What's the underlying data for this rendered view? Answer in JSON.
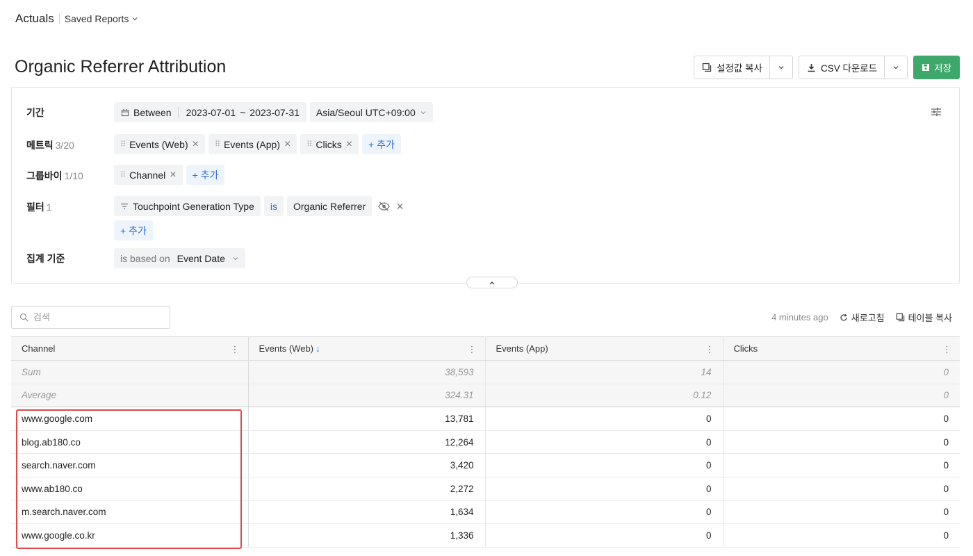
{
  "nav": {
    "brand": "Actuals",
    "saved_reports": "Saved Reports"
  },
  "page": {
    "title": "Organic Referrer Attribution"
  },
  "actions": {
    "copy_settings": "설정값 복사",
    "csv_download": "CSV 다운로드",
    "save": "저장",
    "save_color": "#3ea76a"
  },
  "settings": {
    "period": {
      "label": "기간",
      "mode": "Between",
      "start": "2023-07-01",
      "tilde": "~",
      "end": "2023-07-31",
      "timezone": "Asia/Seoul UTC+09:00"
    },
    "metrics": {
      "label": "메트릭",
      "count": "3/20",
      "items": [
        "Events (Web)",
        "Events (App)",
        "Clicks"
      ],
      "add": "+ 추가"
    },
    "groupby": {
      "label": "그룹바이",
      "count": "1/10",
      "items": [
        "Channel"
      ],
      "add": "+ 추가"
    },
    "filter": {
      "label": "필터",
      "count": "1",
      "field": "Touchpoint Generation Type",
      "op": "is",
      "value": "Organic Referrer",
      "add": "+ 추가"
    },
    "aggregation": {
      "label": "집계 기준",
      "prefix": "is based on",
      "value": "Event Date"
    }
  },
  "table_tools": {
    "search_placeholder": "검색",
    "updated": "4 minutes ago",
    "refresh": "새로고침",
    "copy_table": "테이블 복사"
  },
  "table": {
    "columns": [
      "Channel",
      "Events (Web)",
      "Events (App)",
      "Clicks"
    ],
    "sort_indicator": "↓",
    "summary": [
      {
        "label": "Sum",
        "web": "38,593",
        "app": "14",
        "clicks": "0"
      },
      {
        "label": "Average",
        "web": "324.31",
        "app": "0.12",
        "clicks": "0"
      }
    ],
    "rows": [
      {
        "channel": "www.google.com",
        "web": "13,781",
        "app": "0",
        "clicks": "0"
      },
      {
        "channel": "blog.ab180.co",
        "web": "12,264",
        "app": "0",
        "clicks": "0"
      },
      {
        "channel": "search.naver.com",
        "web": "3,420",
        "app": "0",
        "clicks": "0"
      },
      {
        "channel": "www.ab180.co",
        "web": "2,272",
        "app": "0",
        "clicks": "0"
      },
      {
        "channel": "m.search.naver.com",
        "web": "1,634",
        "app": "0",
        "clicks": "0"
      },
      {
        "channel": "www.google.co.kr",
        "web": "1,336",
        "app": "0",
        "clicks": "0"
      }
    ]
  },
  "colors": {
    "accent": "#2f6fd6",
    "highlight": "#e0474c"
  }
}
